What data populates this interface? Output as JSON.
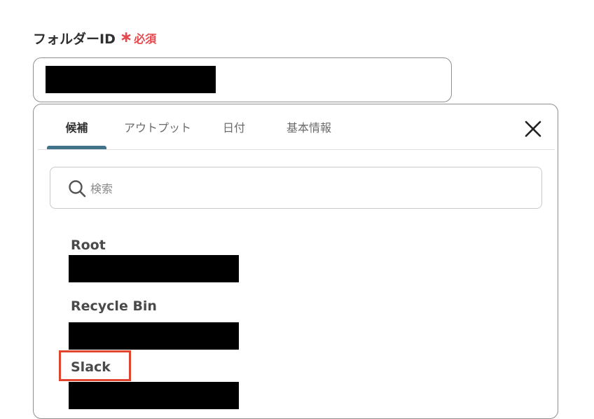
{
  "field": {
    "label": "フォルダーID",
    "required_mark": "∗",
    "required_text": "必須"
  },
  "tabs": [
    {
      "label": "候補",
      "active": true
    },
    {
      "label": "アウトプット",
      "active": false
    },
    {
      "label": "日付",
      "active": false
    },
    {
      "label": "基本情報",
      "active": false
    }
  ],
  "search": {
    "placeholder": "検索"
  },
  "folders": [
    {
      "name": "Root"
    },
    {
      "name": "Recycle Bin"
    },
    {
      "name": "Slack",
      "highlighted": true
    }
  ],
  "colors": {
    "required": "#e5484d",
    "tab_indicator": "#41738a",
    "highlight": "#e0452e"
  },
  "icons": {
    "close": "close-icon",
    "search": "search-icon"
  }
}
